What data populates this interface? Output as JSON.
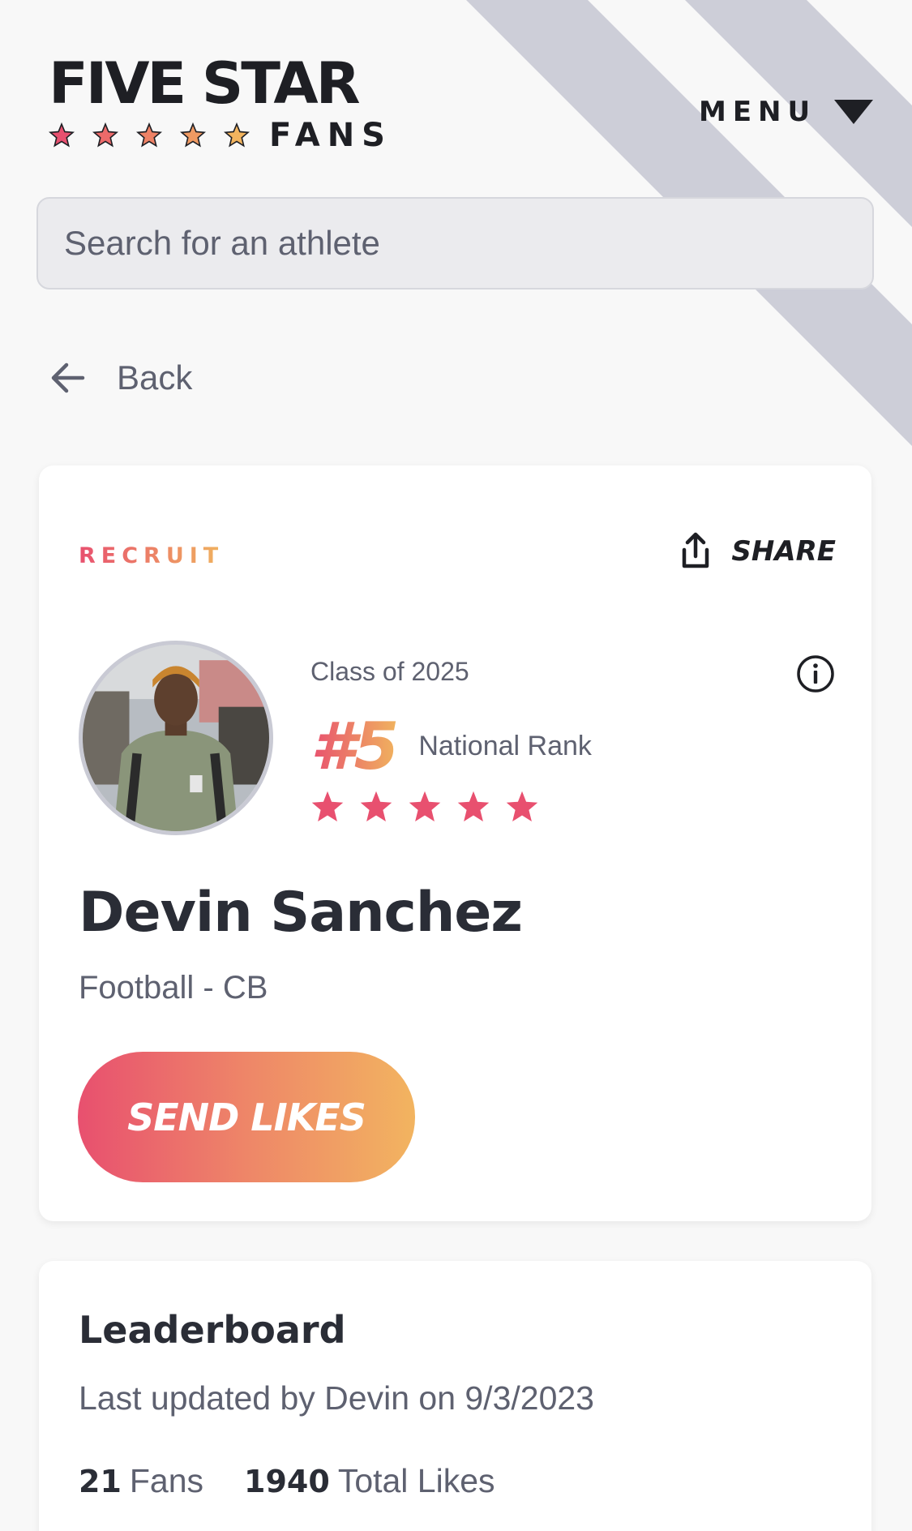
{
  "header": {
    "logo_line1": "FIVE STAR",
    "logo_line2": "FANS",
    "menu_label": "MENU"
  },
  "search": {
    "placeholder": "Search for an athlete"
  },
  "nav": {
    "back_label": "Back"
  },
  "profile": {
    "badge": "RECRUIT",
    "share_label": "SHARE",
    "class_of": "Class of 2025",
    "rank": "#5",
    "rank_label": "National Rank",
    "star_rating": 5,
    "name": "Devin Sanchez",
    "sport_position": "Football - CB",
    "send_likes_label": "SEND LIKES"
  },
  "leaderboard": {
    "title": "Leaderboard",
    "updated": "Last updated by Devin on 9/3/2023",
    "fans_count": "21",
    "fans_label": "Fans",
    "likes_count": "1940",
    "likes_label": "Total Likes"
  },
  "colors": {
    "accent_pink": "#e8506f",
    "accent_orange": "#f0b35e",
    "stripe": "#cdced8",
    "text_dark": "#2a2d36",
    "text_muted": "#5e6170"
  }
}
